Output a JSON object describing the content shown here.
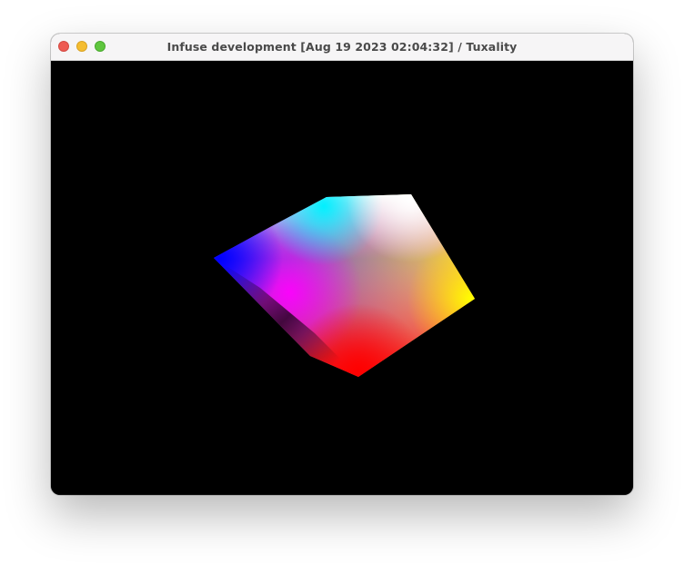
{
  "window": {
    "title": "Infuse development [Aug 19 2023 02:04:32] / Tuxality",
    "background_color": "#000000"
  },
  "titlebar": {
    "buttons": [
      {
        "name": "close-icon",
        "color": "#ee5a52"
      },
      {
        "name": "minimize-icon",
        "color": "#f5bd30"
      },
      {
        "name": "zoom-icon",
        "color": "#5fc63e"
      }
    ]
  },
  "scene": {
    "object": "rgb-color-cube",
    "vertex_colors": [
      "#0000ff",
      "#00ffff",
      "#ffffff",
      "#ffff00",
      "#ff0000",
      "#ff00ff",
      "#000000"
    ]
  }
}
